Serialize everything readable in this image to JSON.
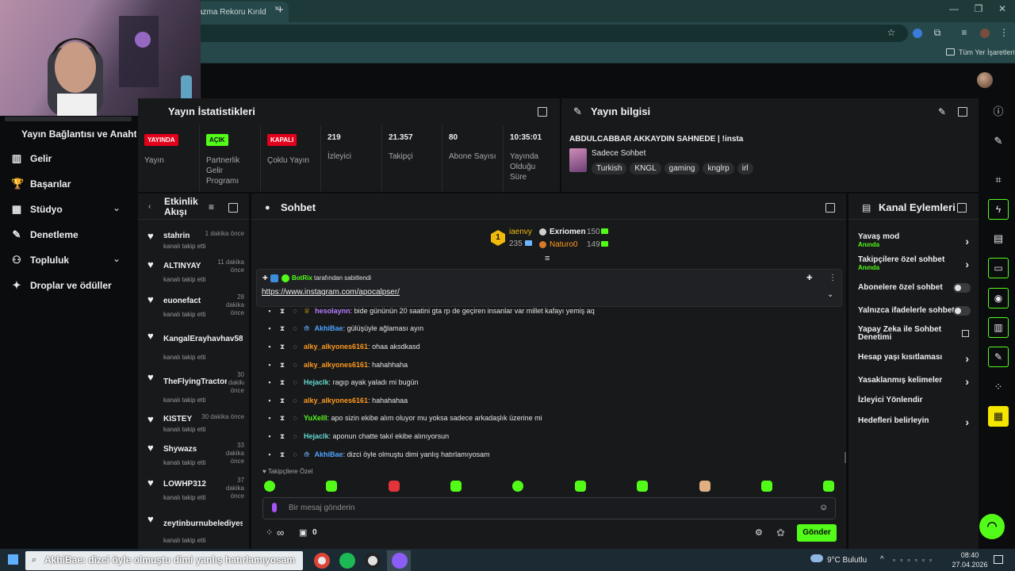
{
  "browser": {
    "tab_title": "azma Rekoru Kırıld",
    "tab_close": "×",
    "new_tab": "+",
    "bookmarks_label": "Tüm Yer İşaretleri",
    "window_controls": [
      "—",
      "❐",
      "✕"
    ]
  },
  "nav": {
    "stream_link": "Yayın Bağlantısı ve Anahtarı",
    "items": [
      {
        "label": "Gelir",
        "icon": "bank-icon"
      },
      {
        "label": "Başarılar",
        "icon": "trophy-icon"
      },
      {
        "label": "Stüdyo",
        "icon": "studio-icon",
        "chevron": "⌄"
      },
      {
        "label": "Denetleme",
        "icon": "wrench-icon"
      },
      {
        "label": "Topluluk",
        "icon": "community-icon",
        "chevron": "⌄"
      },
      {
        "label": "Droplar ve ödüller",
        "icon": "gift-icon"
      }
    ]
  },
  "stats": {
    "title": "Yayın İstatistikleri",
    "cells": [
      {
        "badge": "YAYINDA",
        "badge_color": "#e3001b",
        "label": "Yayın"
      },
      {
        "badge": "AÇIK",
        "badge_color": "#53fc18",
        "label": "Partnerlik Gelir Programı"
      },
      {
        "badge": "KAPALI",
        "badge_color": "#e3001b",
        "label": "Çoklu Yayın"
      },
      {
        "value": "219",
        "label": "İzleyici"
      },
      {
        "value": "21.357",
        "label": "Takipçi"
      },
      {
        "value": "80",
        "label": "Abone Sayısı"
      },
      {
        "value": "10:35:01",
        "label": "Yayında Olduğu Süre"
      }
    ]
  },
  "info": {
    "title": "Yayın bilgisi",
    "stream_title": "ABDULCABBAR AKKAYDIN SAHNEDE | !insta",
    "category": "Sadece Sohbet",
    "tags": [
      "Turkish",
      "KNGL",
      "gaming",
      "knglrp",
      "irl"
    ]
  },
  "activity": {
    "title_line1": "Etkinlik",
    "title_line2": "Akışı",
    "rows": [
      {
        "name": "stahrin",
        "time": "1 dakika önce",
        "sub": "kanalı takip etti"
      },
      {
        "name": "ALTINYAY",
        "time": "11 dakika önce",
        "sub": "kanalı takip etti"
      },
      {
        "name": "euonefact",
        "time": "28 dakika önce",
        "sub": "kanalı takip etti"
      },
      {
        "name": "KangalErayhavhav58",
        "time": "",
        "sub": "kanalı takip etti"
      },
      {
        "name": "TheFlyingTractor",
        "time": "30 dakika önce",
        "sub": "kanalı takip etti"
      },
      {
        "name": "KISTEY",
        "time": "30 dakika önce",
        "sub": "kanalı takip etti"
      },
      {
        "name": "Shywazs",
        "time": "33 dakika önce",
        "sub": "kanalı takip etti"
      },
      {
        "name": "LOWHP312",
        "time": "37 dakika önce",
        "sub": "kanalı takip etti"
      },
      {
        "name": "zeytinburnubelediyes",
        "time": "",
        "sub": "kanalı takip etti"
      }
    ]
  },
  "chat": {
    "title": "Sohbet",
    "leaders": {
      "rank": "1",
      "first": {
        "name": "iaenvy",
        "count": "235"
      },
      "second": {
        "name": "Exriomen",
        "count": "150"
      },
      "third": {
        "name": "Naturo0",
        "count": "149"
      }
    },
    "pinned": {
      "by_user": "BotRix",
      "by_text": "tarafından sabitlendi",
      "link": "https://www.instagram.com/apocalpser/"
    },
    "messages": [
      {
        "user": "hesolaynn",
        "color": "#b57cff",
        "text": ": bide gününün 20 saatini gta rp de geçiren insanlar var millet kafayı yemiş aq"
      },
      {
        "user": "AkhiBae",
        "color": "#4da3ff",
        "text": ": gülüşüyle ağlaması ayın"
      },
      {
        "user": "alky_alkyones6161",
        "color": "#ff9a1f",
        "text": ": ohaa aksdkasd"
      },
      {
        "user": "alky_alkyones6161",
        "color": "#ff9a1f",
        "text": ": hahahhaha"
      },
      {
        "user": "Hejaclk",
        "color": "#66d9d0",
        "text": ": ragıp ayak yaladı mi bugün"
      },
      {
        "user": "alky_alkyones6161",
        "color": "#ff9a1f",
        "text": ": hahahahaa"
      },
      {
        "user": "YuXelll",
        "color": "#53fc18",
        "text": ": apo sizin ekibe alım oluyor mu yoksa sadece arkadaşlık üzerine mi"
      },
      {
        "user": "Hejaclk",
        "color": "#66d9d0",
        "text": ": aponun chatte takıl ekibe alınıyorsun"
      },
      {
        "user": "AkhiBae",
        "color": "#4da3ff",
        "text": ": dizci öyle olmuştu dimi yanlış hatırlamıyosam"
      }
    ],
    "followers_only_label": "Takipçilere Özel",
    "input_placeholder": "Bir mesaj gönderin",
    "infinity": "∞",
    "gift_count": "0",
    "send_label": "Gönder"
  },
  "actions": {
    "title": "Kanal Eylemleri",
    "items": [
      {
        "label": "Yavaş mod",
        "sub": "Anında",
        "control": "chevron"
      },
      {
        "label": "Takipçilere özel sohbet",
        "sub": "Anında",
        "control": "chevron"
      },
      {
        "label": "Abonelere özel sohbet",
        "control": "toggle"
      },
      {
        "label": "Yalnızca ifadelerle sohbet",
        "control": "toggle"
      },
      {
        "label": "Yapay Zeka ile Sohbet Denetimi",
        "control": "external"
      },
      {
        "label": "Hesap yaşı kısıtlaması",
        "control": "chevron"
      },
      {
        "label": "Yasaklanmış kelimeler",
        "control": "chevron"
      },
      {
        "label": "İzleyici Yönlendir",
        "control": "none"
      },
      {
        "label": "Hedefleri belirleyin",
        "control": "chevron"
      }
    ]
  },
  "taskbar": {
    "overlay_message": "AkhiBae: dizci öyle olmuştu dimi yanlış hatırlamıyosam",
    "weather": "9°C Bulutlu",
    "time": "08:40",
    "date": "27.04.2026"
  },
  "colors": {
    "accent": "#53fc18",
    "live_red": "#e3001b",
    "panel_bg": "#18191b"
  }
}
